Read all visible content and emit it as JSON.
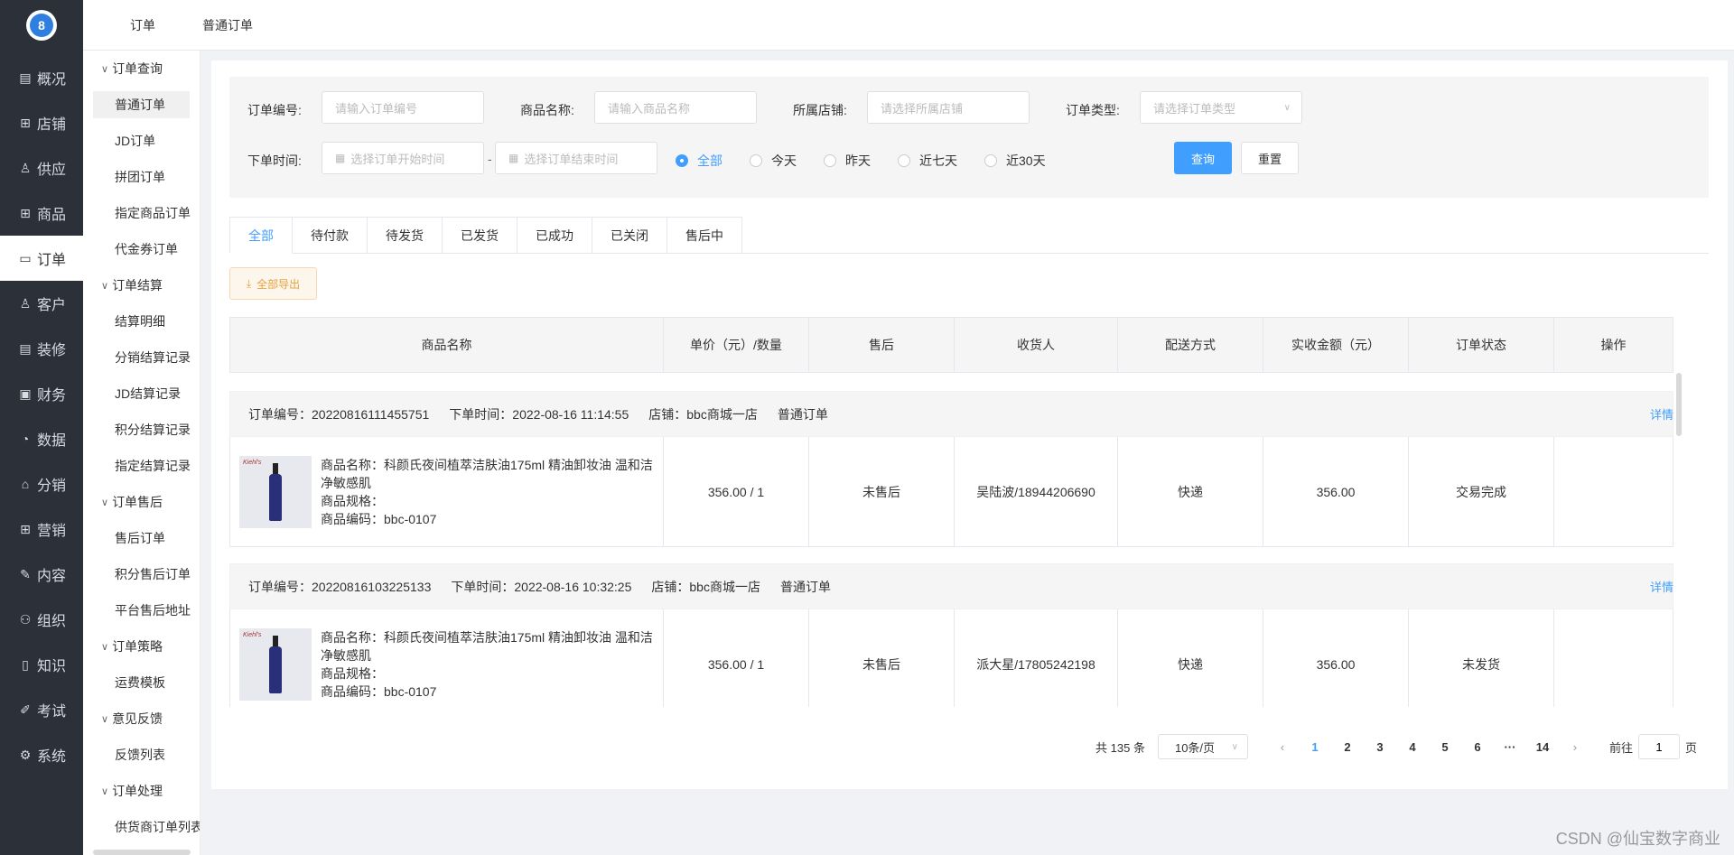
{
  "nav": [
    {
      "label": "概况",
      "icon": "document-icon"
    },
    {
      "label": "店铺",
      "icon": "store-icon"
    },
    {
      "label": "供应",
      "icon": "user-icon"
    },
    {
      "label": "商品",
      "icon": "grid-icon"
    },
    {
      "label": "订单",
      "icon": "chat-icon"
    },
    {
      "label": "客户",
      "icon": "user-icon"
    },
    {
      "label": "装修",
      "icon": "document-icon"
    },
    {
      "label": "财务",
      "icon": "wallet-icon"
    },
    {
      "label": "数据",
      "icon": "chart-icon"
    },
    {
      "label": "分销",
      "icon": "trash-icon"
    },
    {
      "label": "营销",
      "icon": "grid-icon"
    },
    {
      "label": "内容",
      "icon": "edit-icon"
    },
    {
      "label": "组织",
      "icon": "org-icon"
    },
    {
      "label": "知识",
      "icon": "book-icon"
    },
    {
      "label": "考试",
      "icon": "exam-icon"
    },
    {
      "label": "系统",
      "icon": "gear-icon"
    }
  ],
  "breadcrumb": {
    "first": "订单",
    "second": "普通订单"
  },
  "submenu": {
    "g1": "订单查询",
    "g1_items": [
      "普通订单",
      "JD订单",
      "拼团订单",
      "指定商品订单",
      "代金券订单"
    ],
    "g2": "订单结算",
    "g2_items": [
      "结算明细",
      "分销结算记录",
      "JD结算记录",
      "积分结算记录",
      "指定结算记录"
    ],
    "g3": "订单售后",
    "g3_items": [
      "售后订单",
      "积分售后订单",
      "平台售后地址"
    ],
    "g4": "订单策略",
    "g4_items": [
      "运费模板"
    ],
    "g5": "意见反馈",
    "g5_items": [
      "反馈列表"
    ],
    "g6": "订单处理",
    "g6_items": [
      "供货商订单列表"
    ]
  },
  "filter": {
    "order_no_label": "订单编号:",
    "order_no_placeholder": "请输入订单编号",
    "product_label": "商品名称:",
    "product_placeholder": "请输入商品名称",
    "store_label": "所属店铺:",
    "store_placeholder": "请选择所属店铺",
    "type_label": "订单类型:",
    "type_placeholder": "请选择订单类型",
    "time_label": "下单时间:",
    "start_placeholder": "选择订单开始时间",
    "end_placeholder": "选择订单结束时间",
    "sep": "-",
    "radios": [
      "全部",
      "今天",
      "昨天",
      "近七天",
      "近30天"
    ],
    "query": "查询",
    "reset": "重置"
  },
  "tabs": [
    "全部",
    "待付款",
    "待发货",
    "已发货",
    "已成功",
    "已关闭",
    "售后中"
  ],
  "export": "全部导出",
  "columns": [
    "商品名称",
    "单价（元）/数量",
    "售后",
    "收货人",
    "配送方式",
    "实收金额（元）",
    "订单状态",
    "操作"
  ],
  "orders": [
    {
      "order_no": "订单编号：20220816111455751",
      "time": "下单时间：2022-08-16 11:14:55",
      "store": "店铺：bbc商城一店",
      "type": "普通订单",
      "detail": "详情",
      "product_name": "商品名称：科颜氏夜间植萃洁肤油175ml 精油卸妆油 温和洁净敏感肌",
      "spec": "商品规格：",
      "code": "商品编码：bbc-0107",
      "price_qty": "356.00 / 1",
      "aftersale": "未售后",
      "receiver": "吴陆波/18944206690",
      "delivery": "快递",
      "amount": "356.00",
      "status": "交易完成"
    },
    {
      "order_no": "订单编号：20220816103225133",
      "time": "下单时间：2022-08-16 10:32:25",
      "store": "店铺：bbc商城一店",
      "type": "普通订单",
      "detail": "详情",
      "product_name": "商品名称：科颜氏夜间植萃洁肤油175ml 精油卸妆油 温和洁净敏感肌",
      "spec": "商品规格：",
      "code": "商品编码：bbc-0107",
      "price_qty": "356.00 / 1",
      "aftersale": "未售后",
      "receiver": "派大星/17805242198",
      "delivery": "快递",
      "amount": "356.00",
      "status": "未发货"
    }
  ],
  "pager": {
    "total": "共 135 条",
    "size": "10条/页",
    "pages": [
      "1",
      "2",
      "3",
      "4",
      "5",
      "6",
      "···",
      "14"
    ],
    "goto_prefix": "前往",
    "goto_value": "1",
    "goto_suffix": "页"
  },
  "watermark": "CSDN @仙宝数字商业",
  "colors": {
    "primary": "#409eff",
    "nav_bg": "#2b3039",
    "warning": "#e6a23c"
  }
}
